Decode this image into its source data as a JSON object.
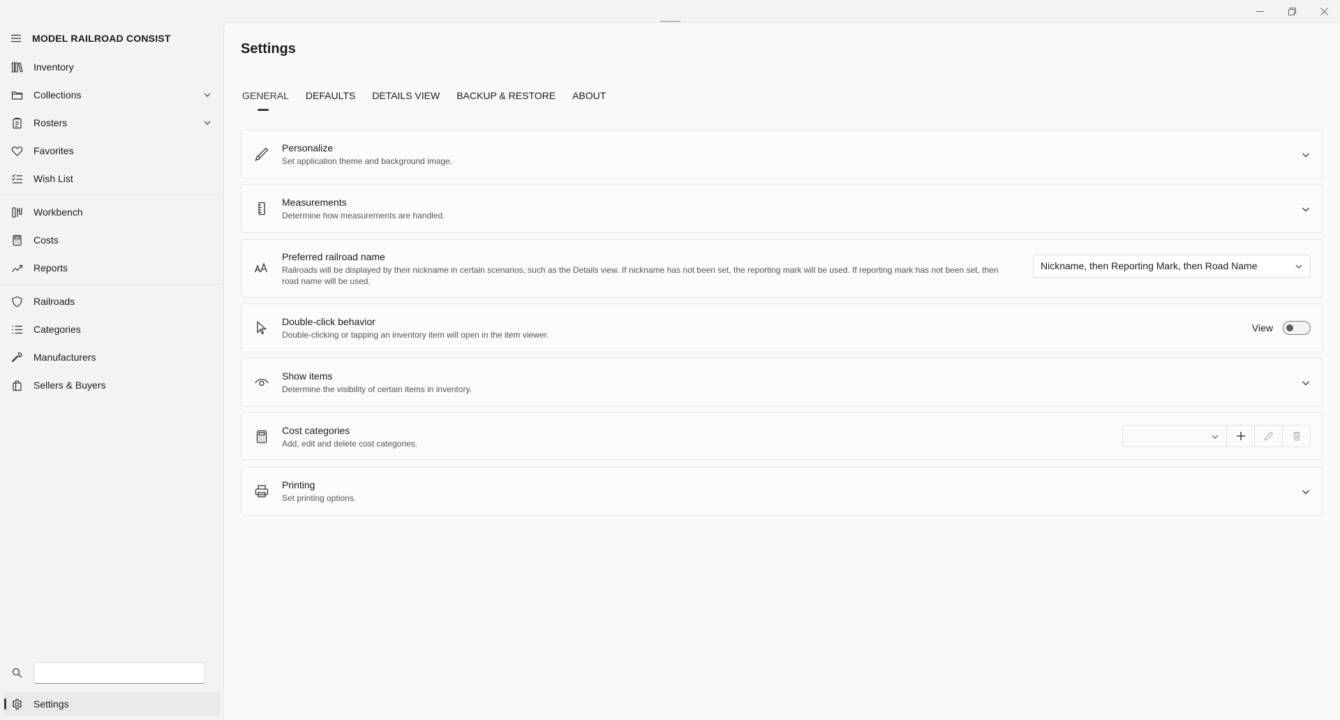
{
  "app": {
    "title": "MODEL RAILROAD CONSIST"
  },
  "sidebar": {
    "items": [
      {
        "label": "Inventory",
        "icon": "library-icon"
      },
      {
        "label": "Collections",
        "icon": "folder-icon"
      },
      {
        "label": "Rosters",
        "icon": "clipboard-icon"
      },
      {
        "label": "Favorites",
        "icon": "heart-icon"
      },
      {
        "label": "Wish List",
        "icon": "checklist-icon"
      },
      {
        "label": "Workbench",
        "icon": "tools-icon"
      },
      {
        "label": "Costs",
        "icon": "calculator-icon"
      },
      {
        "label": "Reports",
        "icon": "trend-icon"
      },
      {
        "label": "Railroads",
        "icon": "shield-icon"
      },
      {
        "label": "Categories",
        "icon": "list-icon"
      },
      {
        "label": "Manufacturers",
        "icon": "wrench-icon"
      },
      {
        "label": "Sellers & Buyers",
        "icon": "shopping-bag-icon"
      }
    ],
    "search": {
      "value": "",
      "placeholder": ""
    },
    "settings_label": "Settings"
  },
  "page": {
    "title": "Settings",
    "tabs": [
      "GENERAL",
      "DEFAULTS",
      "DETAILS VIEW",
      "BACKUP & RESTORE",
      "ABOUT"
    ],
    "active_tab": "GENERAL"
  },
  "cards": {
    "personalize": {
      "title": "Personalize",
      "desc": "Set application theme and background image."
    },
    "measurements": {
      "title": "Measurements",
      "desc": "Determine how measurements are handled."
    },
    "railroad_name": {
      "title": "Preferred railroad name",
      "desc": "Railroads will be displayed by their nickname in certain scenarios, such as the Details view. If nickname has not been set, the reporting mark will be used. If reporting mark has not been set, then road name will be used.",
      "selected": "Nickname, then Reporting Mark, then Road Name"
    },
    "double_click": {
      "title": "Double-click behavior",
      "desc": "Double-clicking or tapping an inventory item will open in the item viewer.",
      "toggle_label": "View",
      "toggle_on": false
    },
    "show_items": {
      "title": "Show items",
      "desc": "Determine the visibility of certain items in inventory."
    },
    "cost_categories": {
      "title": "Cost categories",
      "desc": "Add, edit and delete cost categories.",
      "selected": ""
    },
    "printing": {
      "title": "Printing",
      "desc": "Set printing options."
    }
  }
}
